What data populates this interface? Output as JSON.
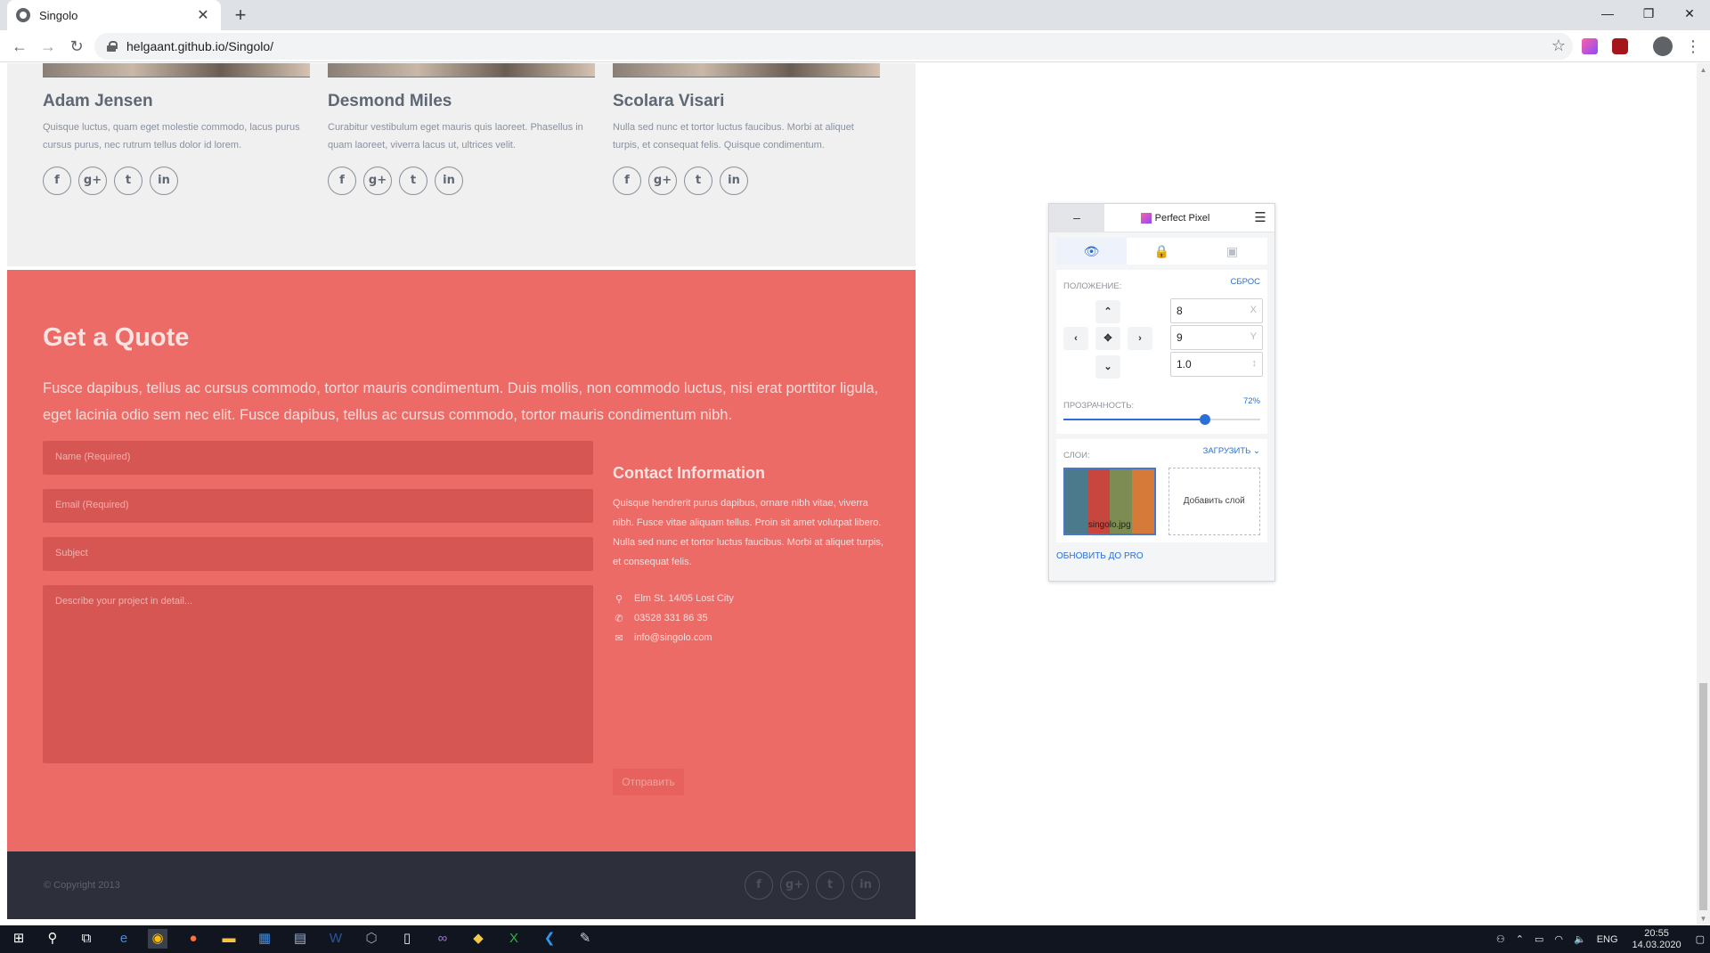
{
  "browser": {
    "tab_title": "Singolo",
    "tab_close": "✕",
    "new_tab": "+",
    "url": "helgaant.github.io/Singolo/",
    "window_controls": [
      "—",
      "❐",
      "✕"
    ]
  },
  "team": {
    "members": [
      {
        "name": "Adam Jensen",
        "bio": "Quisque luctus, quam eget molestie commodo, lacus purus cursus purus, nec rutrum tellus dolor id lorem.",
        "socials": [
          "f",
          "g+",
          "t",
          "in"
        ]
      },
      {
        "name": "Desmond Miles",
        "bio": "Curabitur vestibulum eget mauris quis laoreet. Phasellus in quam laoreet, viverra lacus ut, ultrices velit.",
        "socials": [
          "f",
          "g+",
          "t",
          "in"
        ]
      },
      {
        "name": "Scolara Visari",
        "bio": "Nulla sed nunc et tortor luctus faucibus. Morbi at aliquet turpis, et consequat felis. Quisque condimentum.",
        "socials": [
          "f",
          "g+",
          "t",
          "in"
        ]
      }
    ]
  },
  "quote": {
    "title": "Get a Quote",
    "lead": "Fusce dapibus, tellus ac cursus commodo, tortor mauris condimentum. Duis mollis, non commodo luctus, nisi erat porttitor ligula, eget lacinia odio sem nec elit. Fusce dapibus, tellus ac cursus commodo, tortor mauris condimentum nibh.",
    "name_placeholder": "Name (Required)",
    "email_placeholder": "Email (Required)",
    "subject_placeholder": "Subject",
    "message_placeholder": "Describe your project in detail...",
    "send_label": "Отправить",
    "contact": {
      "title": "Contact Information",
      "text": "Quisque hendrerit purus dapibus, ornare nibh vitae, viverra nibh. Fusce vitae aliquam tellus. Proin sit amet volutpat libero. Nulla sed nunc et tortor luctus faucibus. Morbi at aliquet turpis, et consequat felis.",
      "address": "Elm St. 14/05 Lost City",
      "phone": "03528 331 86 35",
      "email": "info@singolo.com"
    }
  },
  "footer": {
    "copyright": "© Copyright 2013",
    "socials": [
      "f",
      "g+",
      "t",
      "in"
    ]
  },
  "perfect_pixel": {
    "minimize": "–",
    "brand": "Perfect Pixel",
    "position_label": "ПОЛОЖЕНИЕ:",
    "reset_label": "СБРОС",
    "x_value": "8",
    "x_unit": "X",
    "y_value": "9",
    "y_unit": "Y",
    "scale_value": "1.0",
    "scale_unit": "↕",
    "opacity_label": "ПРОЗРАЧНОСТЬ:",
    "opacity_value": "72%",
    "opacity_fraction": 0.72,
    "layers_label": "СЛОИ:",
    "upload_label": "ЗАГРУЗИТЬ ⌄",
    "layer_name": "singolo.jpg",
    "add_layer": "Добавить слой",
    "upgrade": "ОБНОВИТЬ ДО PRO"
  },
  "taskbar": {
    "lang": "ENG",
    "time": "20:55",
    "date": "14.03.2020"
  }
}
